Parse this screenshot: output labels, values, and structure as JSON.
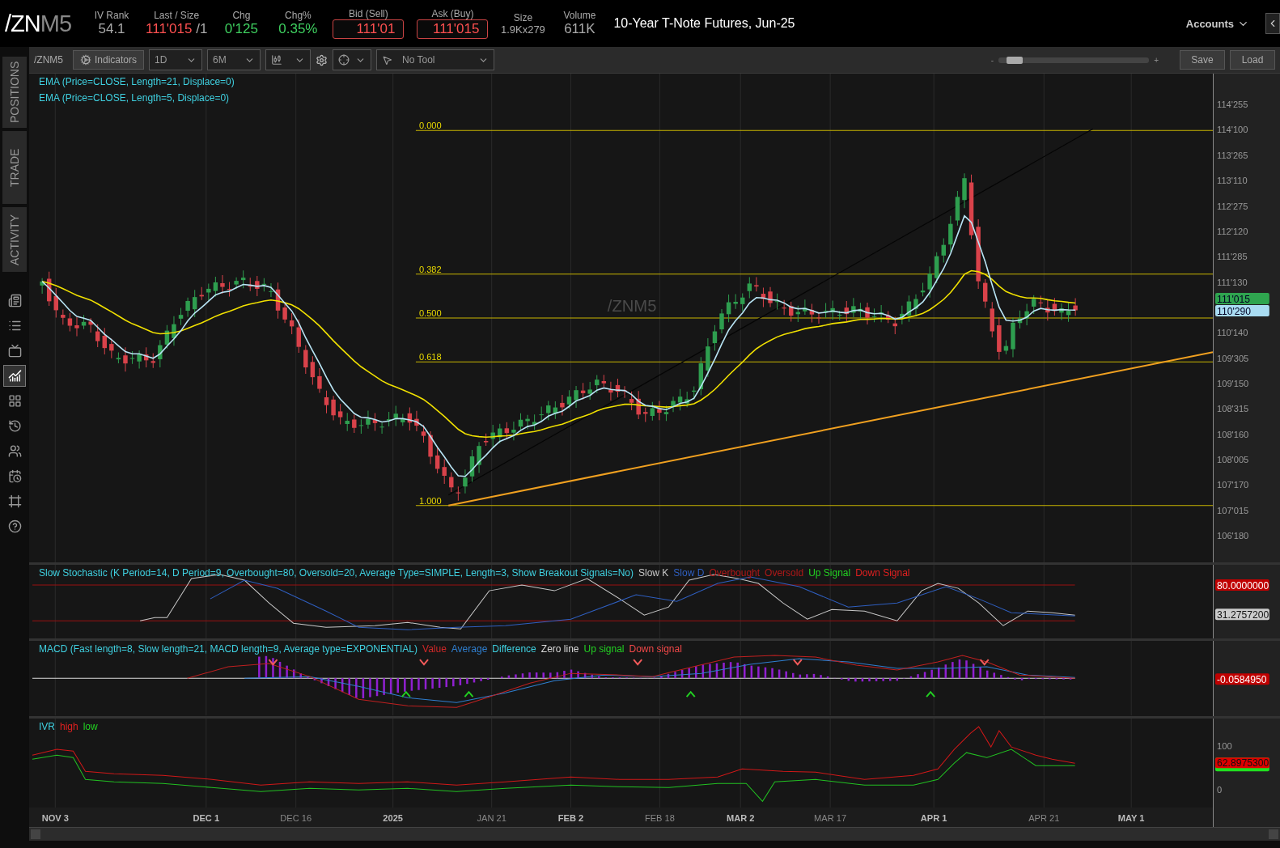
{
  "header": {
    "symbol": "/ZN",
    "symbol_suffix": "M5",
    "fields": [
      {
        "label": "IV Rank",
        "value": "54.1",
        "kind": "plain"
      },
      {
        "label": "Last / Size",
        "value": "111'015",
        "extra": "/1",
        "kind": "down"
      },
      {
        "label": "Chg",
        "value": "0'125",
        "kind": "up"
      },
      {
        "label": "Chg%",
        "value": "0.35%",
        "kind": "up"
      },
      {
        "label": "Bid (Sell)",
        "value": "111'01",
        "kind": "boxed"
      },
      {
        "label": "Ask (Buy)",
        "value": "111'015",
        "kind": "boxed"
      },
      {
        "label": "Size",
        "value": "1.9Kx279",
        "kind": "small"
      },
      {
        "label": "Volume",
        "value": "611K",
        "kind": "plain"
      }
    ],
    "description": "10-Year T-Note Futures, Jun-25",
    "accounts": "Accounts"
  },
  "sidebar": {
    "tabs": [
      "POSITIONS",
      "TRADE",
      "ACTIVITY"
    ],
    "tools": [
      {
        "kind": "news",
        "selected": false
      },
      {
        "kind": "list",
        "selected": false
      },
      {
        "kind": "tv",
        "selected": false
      },
      {
        "kind": "chart",
        "selected": true
      },
      {
        "kind": "grid",
        "selected": false
      },
      {
        "kind": "clock",
        "selected": false
      },
      {
        "kind": "people",
        "selected": false
      },
      {
        "kind": "calendar",
        "selected": false
      },
      {
        "kind": "frame",
        "selected": false
      },
      {
        "kind": "help",
        "selected": false
      }
    ]
  },
  "toolbar": {
    "symbol": "/ZNM5",
    "indicators": "Indicators",
    "aggregation": "1D",
    "period": "6M",
    "tool": "No Tool",
    "zoom": {
      "minus": "-",
      "plus": "+",
      "level": 0.06
    },
    "save": "Save",
    "load": "Load"
  },
  "price_chart": {
    "studies": [
      "EMA (Price=CLOSE, Length=21, Displace=0)",
      "EMA (Price=CLOSE, Length=5, Displace=0)"
    ],
    "watermark": "/ZNM5",
    "fib_levels": [
      "0.000",
      "0.382",
      "0.500",
      "0.618",
      "1.000"
    ],
    "axis": [
      "114'255",
      "114'100",
      "113'265",
      "113'110",
      "112'275",
      "112'120",
      "111'285",
      "111'130",
      "110'140",
      "109'305",
      "109'150",
      "108'315",
      "108'160",
      "108'005",
      "107'170",
      "107'015",
      "106'180"
    ],
    "badges": [
      {
        "value": "111'015",
        "color": "#2fa54f"
      },
      {
        "value": "110'290",
        "color": "#a9dcf2"
      }
    ]
  },
  "stochastic": {
    "legend": [
      {
        "text": "Slow Stochastic (K Period=14, D Period=9, Overbought=80, Oversold=20, Average Type=SIMPLE, Length=3, Show Breakout Signals=No)",
        "color": "#3fd0e0"
      },
      {
        "text": "Slow K",
        "color": "#c8c8c8"
      },
      {
        "text": "Slow D",
        "color": "#2f5fc0"
      },
      {
        "text": "Overbought",
        "color": "#b01818"
      },
      {
        "text": "Oversold",
        "color": "#b01818"
      },
      {
        "text": "Up Signal",
        "color": "#22d022"
      },
      {
        "text": "Down Signal",
        "color": "#e02020"
      }
    ],
    "badges": [
      {
        "value": "80.0000000",
        "color": "#c00000"
      },
      {
        "value": "31.2757200",
        "color": "#cccccc"
      }
    ]
  },
  "macd": {
    "legend": [
      {
        "text": "MACD (Fast length=8, Slow length=21, MACD length=9, Average type=EXPONENTIAL)",
        "color": "#3fd0e0"
      },
      {
        "text": "Value",
        "color": "#d02828"
      },
      {
        "text": "Average",
        "color": "#2f7fd0"
      },
      {
        "text": "Difference",
        "color": "#3fd0e0"
      },
      {
        "text": "Zero line",
        "color": "#d8d8d8"
      },
      {
        "text": "Up signal",
        "color": "#22d022"
      },
      {
        "text": "Down signal",
        "color": "#f04848"
      }
    ],
    "badge": "-0.0584950"
  },
  "ivr": {
    "legend": [
      {
        "text": "IVR",
        "color": "#3fd0e0"
      },
      {
        "text": "high",
        "color": "#e02020"
      },
      {
        "text": "low",
        "color": "#22d022"
      }
    ],
    "axis": [
      "100",
      "0"
    ],
    "badge": "62.8975300"
  },
  "time_axis": [
    {
      "label": "NOV 3",
      "major": true
    },
    {
      "label": "DEC 1",
      "major": true
    },
    {
      "label": "DEC 16",
      "major": false
    },
    {
      "label": "2025",
      "major": true
    },
    {
      "label": "JAN 21",
      "major": false
    },
    {
      "label": "FEB 2",
      "major": true
    },
    {
      "label": "FEB 18",
      "major": false
    },
    {
      "label": "MAR 2",
      "major": true
    },
    {
      "label": "MAR 17",
      "major": false
    },
    {
      "label": "APR 1",
      "major": true
    },
    {
      "label": "APR 21",
      "major": false
    },
    {
      "label": "MAY 1",
      "major": true
    }
  ]
}
